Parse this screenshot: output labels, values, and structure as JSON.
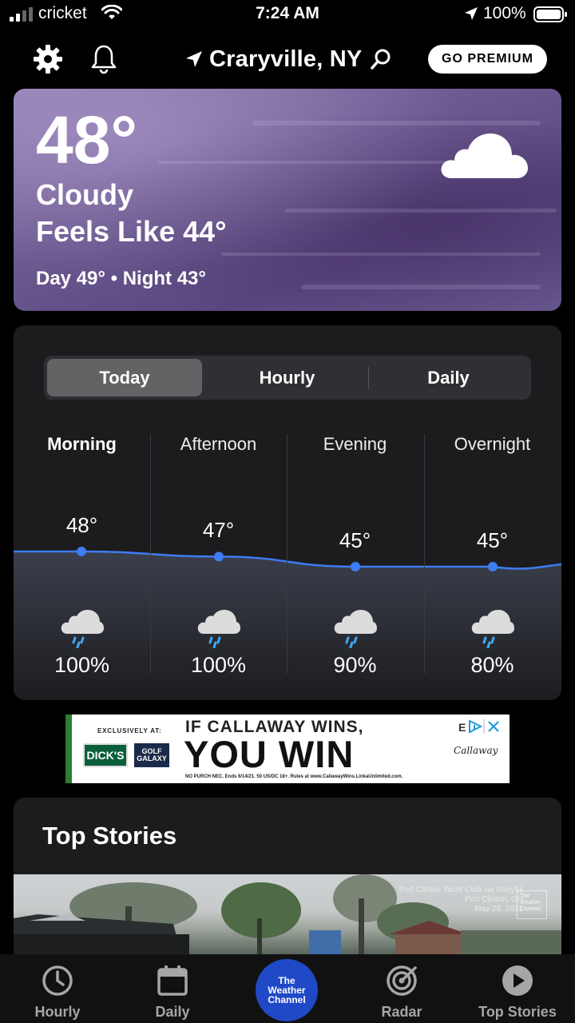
{
  "status_bar": {
    "carrier": "cricket",
    "time": "7:24 AM",
    "battery": "100%"
  },
  "header": {
    "location": "Craryville, NY",
    "premium_label": "GO PREMIUM",
    "icons": [
      "gear-icon",
      "bell-icon",
      "location-arrow-icon",
      "search-icon"
    ]
  },
  "current": {
    "temperature": "48°",
    "condition": "Cloudy",
    "feels_like": "Feels Like 44°",
    "day_night": "Day 49° • Night 43°",
    "icon": "cloud-icon"
  },
  "forecast": {
    "tabs": [
      {
        "label": "Today",
        "active": true
      },
      {
        "label": "Hourly",
        "active": false
      },
      {
        "label": "Daily",
        "active": false
      }
    ],
    "periods": [
      {
        "label": "Morning",
        "temp": "48°",
        "temp_value": 48,
        "precip": "100%",
        "icon": "rain-cloud-icon",
        "active": true
      },
      {
        "label": "Afternoon",
        "temp": "47°",
        "temp_value": 47,
        "precip": "100%",
        "icon": "rain-cloud-icon",
        "active": false
      },
      {
        "label": "Evening",
        "temp": "45°",
        "temp_value": 45,
        "precip": "90%",
        "icon": "rain-cloud-icon",
        "active": false
      },
      {
        "label": "Overnight",
        "temp": "45°",
        "temp_value": 45,
        "precip": "80%",
        "icon": "rain-cloud-icon",
        "active": false
      }
    ],
    "line_color": "#3d7cf2"
  },
  "ad": {
    "exclusive": "EXCLUSIVELY AT:",
    "store1": "DICK'S",
    "store2": "GOLF GALAXY",
    "headline": "IF CALLAWAY WINS,",
    "big": "YOU WIN",
    "fine_print": "NO PURCH NEC. Ends 6/14/21. 50 US/DC 18+. Rules at www.CallawayWins.LinkaUnlimited.com.",
    "brand": "Callaway"
  },
  "top_stories": {
    "title": "Top Stories",
    "caption_line1": "Port Clinton Yacht Club via Storyful",
    "caption_line2": "Port Clinton, OH",
    "caption_line3": "May 28, 2021",
    "logo_text": "The Weather Channel"
  },
  "bottom_nav": {
    "items": [
      {
        "label": "Hourly",
        "icon": "clock-icon"
      },
      {
        "label": "Daily",
        "icon": "calendar-icon"
      },
      {
        "label": "Radar",
        "icon": "radar-icon"
      },
      {
        "label": "Top Stories",
        "icon": "play-icon"
      }
    ],
    "center": {
      "line1": "The",
      "line2": "Weather",
      "line3": "Channel"
    }
  },
  "colors": {
    "accent_blue": "#3d7cf2",
    "card_bg": "#1c1c1e",
    "twc_blue": "#1f49c7"
  }
}
